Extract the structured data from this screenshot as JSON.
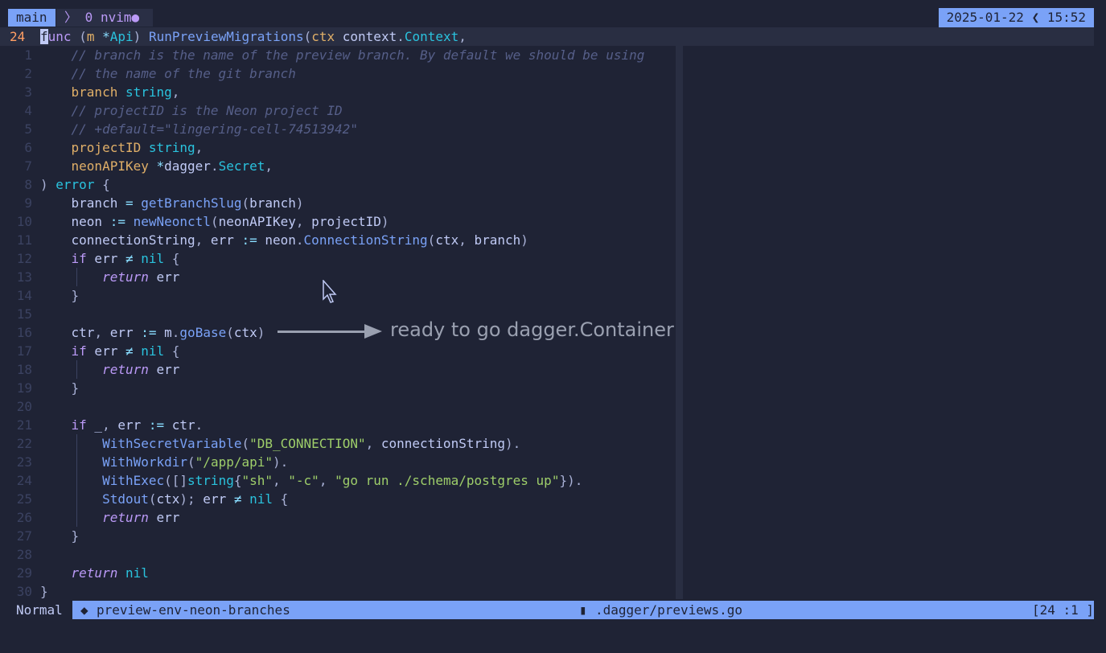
{
  "tmux": {
    "session": "main",
    "window_icon": "terminal-icon",
    "window_index": "0",
    "window_name": "nvim",
    "window_flag": "●",
    "clock": "2025-01-22 ❮ 15:52"
  },
  "editor": {
    "current_line_number": "24",
    "lines": [
      {
        "num": "1",
        "tokens": [
          {
            "c": "c",
            "t": "    // branch is the name of the preview branch. By default we should be using"
          }
        ]
      },
      {
        "num": "2",
        "tokens": [
          {
            "c": "c",
            "t": "    // the name of the git branch"
          }
        ]
      },
      {
        "num": "3",
        "tokens": [
          {
            "c": "",
            "t": "    "
          },
          {
            "c": "p",
            "t": "branch"
          },
          {
            "c": "",
            "t": " "
          },
          {
            "c": "t",
            "t": "string"
          },
          {
            "c": "b",
            "t": ","
          }
        ]
      },
      {
        "num": "4",
        "tokens": [
          {
            "c": "c",
            "t": "    // projectID is the Neon project ID"
          }
        ]
      },
      {
        "num": "5",
        "tokens": [
          {
            "c": "c",
            "t": "    // +default=\"lingering-cell-74513942\""
          }
        ]
      },
      {
        "num": "6",
        "tokens": [
          {
            "c": "",
            "t": "    "
          },
          {
            "c": "p",
            "t": "projectID"
          },
          {
            "c": "",
            "t": " "
          },
          {
            "c": "t",
            "t": "string"
          },
          {
            "c": "b",
            "t": ","
          }
        ]
      },
      {
        "num": "7",
        "tokens": [
          {
            "c": "",
            "t": "    "
          },
          {
            "c": "p",
            "t": "neonAPIKey"
          },
          {
            "c": "",
            "t": " "
          },
          {
            "c": "o",
            "t": "*"
          },
          {
            "c": "",
            "t": "dagger"
          },
          {
            "c": "b",
            "t": "."
          },
          {
            "c": "t",
            "t": "Secret"
          },
          {
            "c": "b",
            "t": ","
          }
        ]
      },
      {
        "num": "8",
        "tokens": [
          {
            "c": "b",
            "t": ")"
          },
          {
            "c": "",
            "t": " "
          },
          {
            "c": "t",
            "t": "error"
          },
          {
            "c": "",
            "t": " "
          },
          {
            "c": "b",
            "t": "{"
          }
        ]
      },
      {
        "num": "9",
        "tokens": [
          {
            "c": "",
            "t": "    branch "
          },
          {
            "c": "o",
            "t": "="
          },
          {
            "c": "",
            "t": " "
          },
          {
            "c": "f",
            "t": "getBranchSlug"
          },
          {
            "c": "b",
            "t": "("
          },
          {
            "c": "",
            "t": "branch"
          },
          {
            "c": "b",
            "t": ")"
          }
        ]
      },
      {
        "num": "10",
        "tokens": [
          {
            "c": "",
            "t": "    neon "
          },
          {
            "c": "o",
            "t": ":="
          },
          {
            "c": "",
            "t": " "
          },
          {
            "c": "f",
            "t": "newNeonctl"
          },
          {
            "c": "b",
            "t": "("
          },
          {
            "c": "",
            "t": "neonAPIKey"
          },
          {
            "c": "b",
            "t": ","
          },
          {
            "c": "",
            "t": " projectID"
          },
          {
            "c": "b",
            "t": ")"
          }
        ]
      },
      {
        "num": "11",
        "tokens": [
          {
            "c": "",
            "t": "    connectionString"
          },
          {
            "c": "b",
            "t": ","
          },
          {
            "c": "",
            "t": " err "
          },
          {
            "c": "o",
            "t": ":="
          },
          {
            "c": "",
            "t": " neon"
          },
          {
            "c": "b",
            "t": "."
          },
          {
            "c": "f",
            "t": "ConnectionString"
          },
          {
            "c": "b",
            "t": "("
          },
          {
            "c": "",
            "t": "ctx"
          },
          {
            "c": "b",
            "t": ","
          },
          {
            "c": "",
            "t": " branch"
          },
          {
            "c": "b",
            "t": ")"
          }
        ]
      },
      {
        "num": "12",
        "tokens": [
          {
            "c": "",
            "t": "    "
          },
          {
            "c": "k",
            "t": "if"
          },
          {
            "c": "",
            "t": " err "
          },
          {
            "c": "o",
            "t": "≠"
          },
          {
            "c": "",
            "t": " "
          },
          {
            "c": "t",
            "t": "nil"
          },
          {
            "c": "",
            "t": " "
          },
          {
            "c": "b",
            "t": "{"
          }
        ]
      },
      {
        "num": "13",
        "tokens": [
          {
            "c": "",
            "t": "        "
          },
          {
            "c": "ki",
            "t": "return"
          },
          {
            "c": "",
            "t": " err"
          }
        ]
      },
      {
        "num": "14",
        "tokens": [
          {
            "c": "",
            "t": "    "
          },
          {
            "c": "b",
            "t": "}"
          }
        ]
      },
      {
        "num": "15",
        "tokens": []
      },
      {
        "num": "16",
        "tokens": [
          {
            "c": "",
            "t": "    ctr"
          },
          {
            "c": "b",
            "t": ","
          },
          {
            "c": "",
            "t": " err "
          },
          {
            "c": "o",
            "t": ":="
          },
          {
            "c": "",
            "t": " m"
          },
          {
            "c": "b",
            "t": "."
          },
          {
            "c": "f",
            "t": "goBase"
          },
          {
            "c": "b",
            "t": "("
          },
          {
            "c": "",
            "t": "ctx"
          },
          {
            "c": "b",
            "t": ")"
          }
        ]
      },
      {
        "num": "17",
        "tokens": [
          {
            "c": "",
            "t": "    "
          },
          {
            "c": "k",
            "t": "if"
          },
          {
            "c": "",
            "t": " err "
          },
          {
            "c": "o",
            "t": "≠"
          },
          {
            "c": "",
            "t": " "
          },
          {
            "c": "t",
            "t": "nil"
          },
          {
            "c": "",
            "t": " "
          },
          {
            "c": "b",
            "t": "{"
          }
        ]
      },
      {
        "num": "18",
        "tokens": [
          {
            "c": "",
            "t": "        "
          },
          {
            "c": "ki",
            "t": "return"
          },
          {
            "c": "",
            "t": " err"
          }
        ]
      },
      {
        "num": "19",
        "tokens": [
          {
            "c": "",
            "t": "    "
          },
          {
            "c": "b",
            "t": "}"
          }
        ]
      },
      {
        "num": "20",
        "tokens": []
      },
      {
        "num": "21",
        "tokens": [
          {
            "c": "",
            "t": "    "
          },
          {
            "c": "k",
            "t": "if"
          },
          {
            "c": "",
            "t": " _"
          },
          {
            "c": "b",
            "t": ","
          },
          {
            "c": "",
            "t": " err "
          },
          {
            "c": "o",
            "t": ":="
          },
          {
            "c": "",
            "t": " ctr"
          },
          {
            "c": "b",
            "t": "."
          }
        ]
      },
      {
        "num": "22",
        "tokens": [
          {
            "c": "",
            "t": "        "
          },
          {
            "c": "f",
            "t": "WithSecretVariable"
          },
          {
            "c": "b",
            "t": "("
          },
          {
            "c": "s",
            "t": "\"DB_CONNECTION\""
          },
          {
            "c": "b",
            "t": ","
          },
          {
            "c": "",
            "t": " connectionString"
          },
          {
            "c": "b",
            "t": ")."
          }
        ]
      },
      {
        "num": "23",
        "tokens": [
          {
            "c": "",
            "t": "        "
          },
          {
            "c": "f",
            "t": "WithWorkdir"
          },
          {
            "c": "b",
            "t": "("
          },
          {
            "c": "s",
            "t": "\"/app/api\""
          },
          {
            "c": "b",
            "t": ")."
          }
        ]
      },
      {
        "num": "24",
        "tokens": [
          {
            "c": "",
            "t": "        "
          },
          {
            "c": "f",
            "t": "WithExec"
          },
          {
            "c": "b",
            "t": "([]"
          },
          {
            "c": "t",
            "t": "string"
          },
          {
            "c": "b",
            "t": "{"
          },
          {
            "c": "s",
            "t": "\"sh\""
          },
          {
            "c": "b",
            "t": ","
          },
          {
            "c": "",
            "t": " "
          },
          {
            "c": "s",
            "t": "\"-c\""
          },
          {
            "c": "b",
            "t": ","
          },
          {
            "c": "",
            "t": " "
          },
          {
            "c": "s",
            "t": "\"go run ./schema/postgres up\""
          },
          {
            "c": "b",
            "t": "})."
          }
        ]
      },
      {
        "num": "25",
        "tokens": [
          {
            "c": "",
            "t": "        "
          },
          {
            "c": "f",
            "t": "Stdout"
          },
          {
            "c": "b",
            "t": "("
          },
          {
            "c": "",
            "t": "ctx"
          },
          {
            "c": "b",
            "t": ");"
          },
          {
            "c": "",
            "t": " err "
          },
          {
            "c": "o",
            "t": "≠"
          },
          {
            "c": "",
            "t": " "
          },
          {
            "c": "t",
            "t": "nil"
          },
          {
            "c": "",
            "t": " "
          },
          {
            "c": "b",
            "t": "{"
          }
        ]
      },
      {
        "num": "26",
        "tokens": [
          {
            "c": "",
            "t": "        "
          },
          {
            "c": "ki",
            "t": "return"
          },
          {
            "c": "",
            "t": " err"
          }
        ]
      },
      {
        "num": "27",
        "tokens": [
          {
            "c": "",
            "t": "    "
          },
          {
            "c": "b",
            "t": "}"
          }
        ]
      },
      {
        "num": "28",
        "tokens": []
      },
      {
        "num": "29",
        "tokens": [
          {
            "c": "",
            "t": "    "
          },
          {
            "c": "ki",
            "t": "return"
          },
          {
            "c": "",
            "t": " "
          },
          {
            "c": "t",
            "t": "nil"
          }
        ]
      },
      {
        "num": "30",
        "tokens": [
          {
            "c": "b",
            "t": "}"
          }
        ]
      }
    ],
    "current_line": [
      {
        "c": "cursor",
        "t": "f"
      },
      {
        "c": "k",
        "t": "unc"
      },
      {
        "c": "",
        "t": " "
      },
      {
        "c": "b",
        "t": "("
      },
      {
        "c": "p",
        "t": "m"
      },
      {
        "c": "",
        "t": " "
      },
      {
        "c": "o",
        "t": "*"
      },
      {
        "c": "t",
        "t": "Api"
      },
      {
        "c": "b",
        "t": ")"
      },
      {
        "c": "",
        "t": " "
      },
      {
        "c": "f",
        "t": "RunPreviewMigrations"
      },
      {
        "c": "b",
        "t": "("
      },
      {
        "c": "p",
        "t": "ctx"
      },
      {
        "c": "",
        "t": " context"
      },
      {
        "c": "b",
        "t": "."
      },
      {
        "c": "t",
        "t": "Context"
      },
      {
        "c": "b",
        "t": ","
      }
    ]
  },
  "annotation": {
    "text": "ready to go dagger.Container"
  },
  "statusline": {
    "mode": "Normal",
    "branch_icon": "git-branch-icon",
    "branch": "preview-env-neon-branches",
    "file_icon": "file-icon",
    "file": ".dagger/previews.go",
    "position": "[24 :1 ]"
  },
  "colors": {
    "background": "#1f2335",
    "accent": "#7aa2f7",
    "keyword": "#bb9af7",
    "comment": "#565f89",
    "string": "#9ece6a"
  }
}
